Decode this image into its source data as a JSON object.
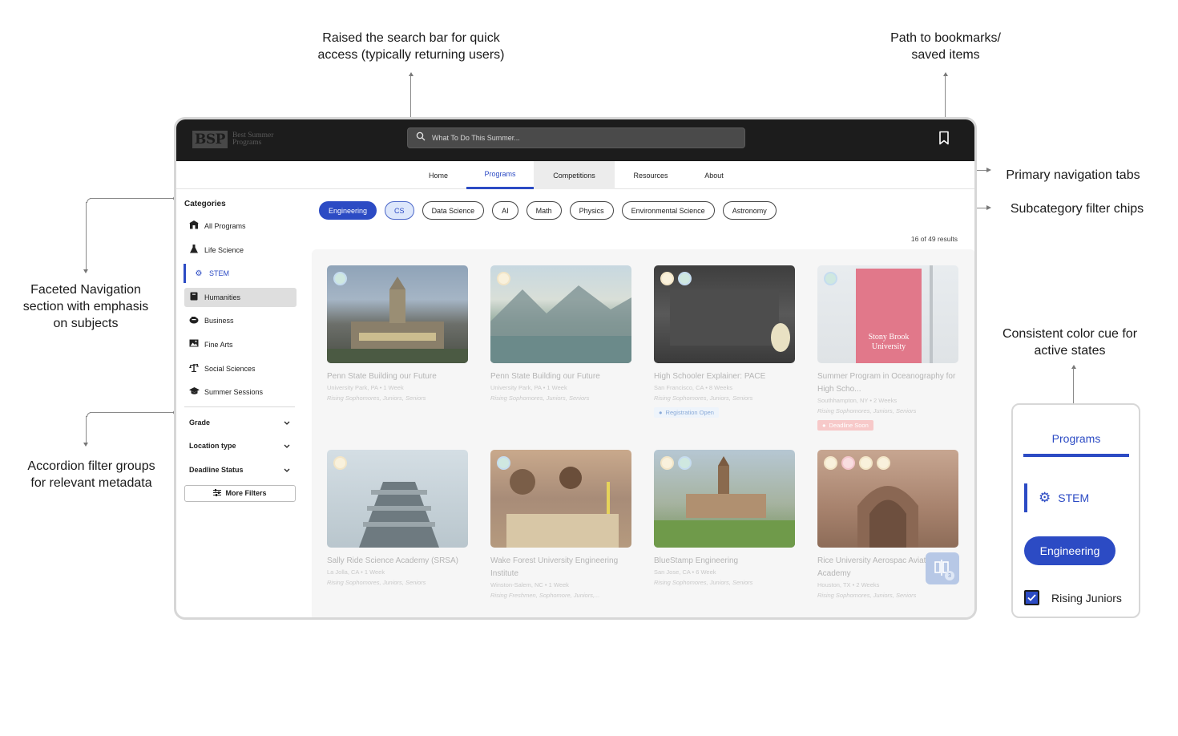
{
  "annotations": {
    "search_note_1": "Raised the search bar for quick",
    "search_note_2": "access (typically returning users)",
    "bookmark_note_1": "Path to bookmarks/",
    "bookmark_note_2": "saved items",
    "nav_note": "Primary navigation tabs",
    "chips_note": "Subcategory filter chips",
    "facet_note_1": "Faceted Navigation",
    "facet_note_2": "section with emphasis",
    "facet_note_3": "on subjects",
    "accordion_note_1": "Accordion filter groups",
    "accordion_note_2": "for relevant metadata",
    "color_note_1": "Consistent color cue for",
    "color_note_2": "active states"
  },
  "header": {
    "logo_mark": "BSP",
    "logo_text": "Best Summer Programs",
    "search_placeholder": "What To Do This Summer..."
  },
  "nav": {
    "tabs": [
      {
        "label": "Home"
      },
      {
        "label": "Programs"
      },
      {
        "label": "Competitions"
      },
      {
        "label": "Resources"
      },
      {
        "label": "About"
      }
    ]
  },
  "sidebar": {
    "title": "Categories",
    "items": [
      {
        "label": "All Programs"
      },
      {
        "label": "Life Science"
      },
      {
        "label": "STEM"
      },
      {
        "label": "Humanities"
      },
      {
        "label": "Business"
      },
      {
        "label": "Fine Arts"
      },
      {
        "label": "Social Sciences"
      },
      {
        "label": "Summer Sessions"
      }
    ],
    "accordions": [
      {
        "label": "Grade"
      },
      {
        "label": "Location type"
      },
      {
        "label": "Deadline Status"
      }
    ],
    "more_filters": "More Filters"
  },
  "chips": [
    {
      "label": "Engineering"
    },
    {
      "label": "CS"
    },
    {
      "label": "Data Science"
    },
    {
      "label": "AI"
    },
    {
      "label": "Math"
    },
    {
      "label": "Physics"
    },
    {
      "label": "Environmental Science"
    },
    {
      "label": "Astronomy"
    }
  ],
  "results_count": "16 of 49 results",
  "cards": [
    {
      "title": "Penn State Building our Future",
      "meta": "University Park, PA • 1 Week",
      "grade": "Rising Sophomores, Juniors, Seniors"
    },
    {
      "title": "Penn State Building our Future",
      "meta": "University Park, PA • 1 Week",
      "grade": "Rising Sophomores, Juniors, Seniors"
    },
    {
      "title": "High Schooler Explainer: PACE",
      "meta": "San Francisco, CA • 8 Weeks",
      "grade": "Rising Sophomores, Juniors, Seniors",
      "status": "Registration Open"
    },
    {
      "title": "Summer Program in Oceanography for High Scho...",
      "meta": "Southhampton, NY • 2 Weeks",
      "grade": "Rising Sophomores, Juniors, Seniors",
      "status": "Deadline Soon"
    },
    {
      "title": "Sally Ride Science Academy (SRSA)",
      "meta": "La Jolla, CA • 1 Week",
      "grade": "Rising Sophomores, Juniors, Seniors"
    },
    {
      "title": "Wake Forest University Engineering Institute",
      "meta": "Winston-Salem, NC • 1 Week",
      "grade": "Rising Freshmen, Sophomore, Juniors,..."
    },
    {
      "title": "BlueStamp Engineering",
      "meta": "San Jose, CA • 6 Week",
      "grade": "Rising Sophomores, Juniors, Seniors"
    },
    {
      "title": "Rice University Aerospac Aviation Academy",
      "meta": "Houston, TX • 2 Weeks",
      "grade": "Rising Sophomores, Juniors, Seniors"
    }
  ],
  "compare_count": "3",
  "callout": {
    "tab": "Programs",
    "side_item": "STEM",
    "chip": "Engineering",
    "checkbox_label": "Rising Juniors"
  },
  "colors": {
    "accent": "#2c4bc4",
    "topbar": "#1c1c1c",
    "chip_light": "#dde7fb"
  }
}
